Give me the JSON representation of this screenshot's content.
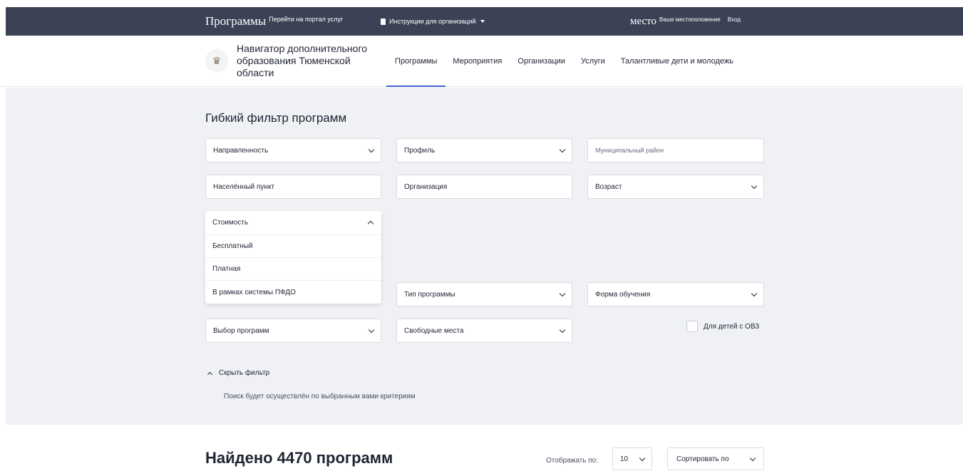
{
  "topbar": {
    "brand": "Программы",
    "portal_link": "Перейти на портал услуг",
    "instructions": "Инструкции для организаций",
    "place": "место",
    "location": "Ваше местоположение",
    "login": "Вход"
  },
  "header": {
    "site_title": "Навигатор дополнительного образования Тюменской области",
    "nav": [
      {
        "label": "Программы",
        "active": true
      },
      {
        "label": "Мероприятия",
        "active": false
      },
      {
        "label": "Организации",
        "active": false
      },
      {
        "label": "Услуги",
        "active": false
      },
      {
        "label": "Талантливые дети и молодежь",
        "active": false
      }
    ]
  },
  "filter": {
    "title": "Гибкий фильтр программ",
    "direction": "Направленность",
    "profile": "Профиль",
    "municipal_placeholder": "Муниципальный район",
    "locality_placeholder": "Населённый пункт",
    "organization_placeholder": "Организация",
    "age": "Возраст",
    "cost": {
      "label": "Стоимость",
      "options": [
        "Бесплатный",
        "Платная",
        "В рамках системы ПФДО"
      ]
    },
    "program_type": "Тип программы",
    "study_form": "Форма обучения",
    "program_choice": "Выбор программ",
    "free_places": "Свободные места",
    "ovz_label": "Для детей с ОВЗ",
    "hide_filter": "Скрыть фильтр",
    "search_note": "Поиск будет осуществлён по выбранным вами критериям"
  },
  "results": {
    "found": "Найдено 4470 программ",
    "show_by_label": "Отображать по:",
    "per_page": "10",
    "sort_label": "Сортировать по"
  },
  "colors": {
    "topbar_bg": "#3b4256",
    "filter_bg": "#eff1f5",
    "accent": "#3d64c7"
  }
}
